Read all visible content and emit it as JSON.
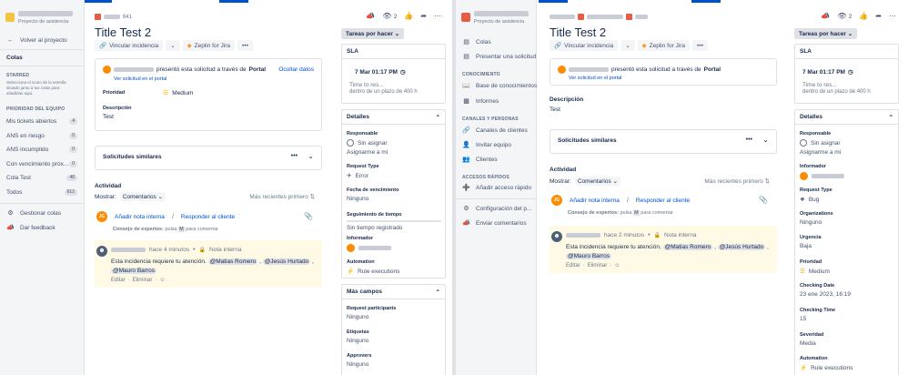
{
  "common": {
    "issue_key": "641",
    "title": "Title Test 2",
    "link_issue": "Vincular incidencia",
    "zeplin": "Zeplin for Jira",
    "watch_count": "2",
    "status_button": "Tareas por hacer",
    "reported_via": "presentó esta solicitud a través de",
    "portal": "Portal",
    "view_portal": "Ver solicitud en el portal",
    "hide_data": "Ocultar datos",
    "similar_requests": "Solicitudes similares",
    "activity": "Actividad",
    "show_label": "Mostrar:",
    "show_value": "Comentarios",
    "newest_first": "Más recientes primero",
    "add_internal": "Añadir nota interna",
    "reply_customer": "Responder al cliente",
    "tip": "Consejo de expertos:",
    "tip_rest": "pulsa",
    "tip_key": "M",
    "tip_end": "para comentar",
    "avatar_initials": "JG"
  },
  "left": {
    "sidebar": {
      "project_subtitle": "Proyecto de asistencia",
      "back": "Volver al proyecto",
      "queues_title": "Colas",
      "starred": "STARRED",
      "starred_desc": "Selecciona el icono de la estrella situado junto a tus colas para añadirlas aquí.",
      "team_priority": "PRIORIDAD DEL EQUIPO",
      "queues": [
        {
          "label": "Mis tickets abiertos",
          "count": "4"
        },
        {
          "label": "ANS en riesgo",
          "count": "0"
        },
        {
          "label": "ANS incumplido",
          "count": "0"
        },
        {
          "label": "Con vencimiento próx...",
          "count": "0"
        },
        {
          "label": "Cola Test",
          "count": "48"
        },
        {
          "label": "Todos",
          "count": "612"
        }
      ],
      "manage_queues": "Gestionar colas",
      "feedback": "Dar feedback"
    },
    "priority_label": "Prioridad",
    "priority_value": "Medium",
    "description_label": "Descripción",
    "description_value": "Test",
    "comment": {
      "time": "hace 4 minutos",
      "internal": "Nota interna",
      "text": "Esta incidencia requiere tu atención.",
      "mentions": [
        "@Matias Romero",
        "@Jesús Hurtado",
        "@Mauro Barros"
      ],
      "edit": "Editar",
      "delete": "Eliminar"
    },
    "sla": {
      "title": "SLA",
      "date": "7 Mar 01:17 PM",
      "name": "Time to res...",
      "within": "dentro de un plazo de 400 h"
    },
    "details": {
      "title": "Detalles",
      "responsible": "Responsable",
      "unassigned": "Sin asignar",
      "assign_me": "Asignarme a mí",
      "request_type": "Request Type",
      "request_type_value": "Error",
      "due_date": "Fecha de vencimiento",
      "none": "Ninguno",
      "time_tracking": "Seguimiento de tiempo",
      "no_time": "Sin tiempo registrado",
      "reporter": "Informador",
      "automation": "Automation",
      "rule_exec": "Rule executions"
    },
    "more_fields": {
      "title": "Más campos",
      "participants": "Request participants",
      "none": "Ninguno",
      "labels": "Etiquetas",
      "approvers": "Approvers"
    }
  },
  "right": {
    "sidebar": {
      "project_subtitle": "Proyecto de asistencia",
      "items": [
        {
          "label": "Colas",
          "icon": "queue-icon"
        },
        {
          "label": "Presentar una solicitud",
          "icon": "form-icon"
        }
      ],
      "knowledge": "CONOCIMIENTO",
      "knowledge_base": "Base de conocimientos",
      "reports": "Informes",
      "channels_people": "CANALES Y PERSONAS",
      "customer_channels": "Canales de clientes",
      "invite_team": "Invitar equipo",
      "customers": "Clientes",
      "quick_access": "ACCESOS RÁPIDOS",
      "add_quick": "Añadir acceso rápido",
      "settings": "Configuración del p...",
      "send_feedback": "Enviar comentarios"
    },
    "description_label": "Descripción",
    "description_value": "Test",
    "comment": {
      "time": "hace 2 minutos",
      "internal": "Nota interna",
      "text": "Esta incidencia requiere tu atención.",
      "mentions": [
        "@Matias Romero",
        "@Jesús Hurtado",
        "@Mauro Barros"
      ],
      "edit": "Editar",
      "delete": "Eliminar"
    },
    "sla": {
      "title": "SLA",
      "date": "7 Mar 01:17 PM",
      "name": "Time to res...",
      "within": "dentro de un plazo de 400 h"
    },
    "details": {
      "title": "Detalles",
      "responsible": "Responsable",
      "unassigned": "Sin asignar",
      "assign_me": "Asignarme a mí",
      "reporter": "Informador",
      "request_type": "Request Type",
      "request_type_value": "Bug",
      "organizations": "Organizations",
      "none": "Ninguno",
      "urgency": "Urgencia",
      "urgency_value": "Baja",
      "priority": "Prioridad",
      "priority_value": "Medium",
      "checking_date": "Checking Date",
      "checking_date_value": "23 ene 2023, 16:19",
      "checking_time": "Checking Time",
      "checking_time_value": "15",
      "severity": "Severidad",
      "severity_value": "Media",
      "automation": "Automation",
      "rule_exec": "Rule executions"
    }
  }
}
